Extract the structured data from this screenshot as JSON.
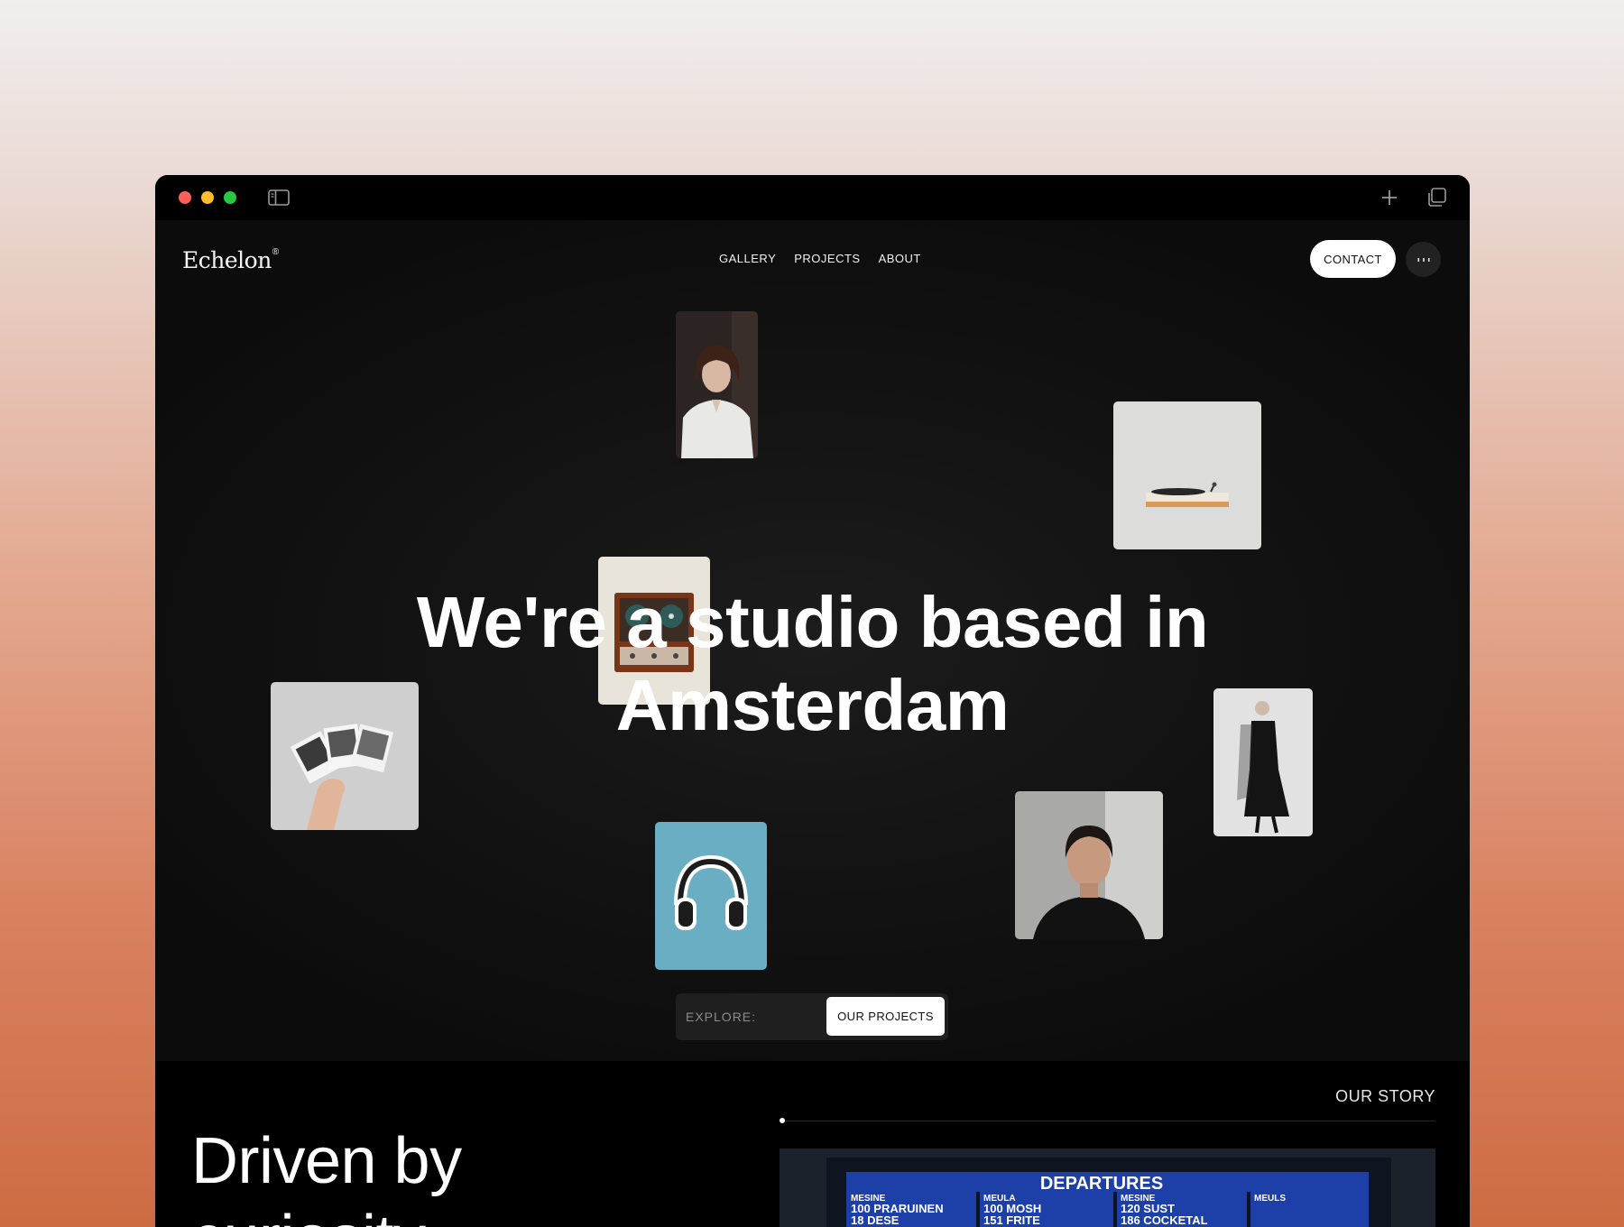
{
  "nav": {
    "logo": "Echelon",
    "logo_mark": "®",
    "links": [
      "GALLERY",
      "PROJECTS",
      "ABOUT"
    ],
    "contact_label": "CONTACT"
  },
  "hero": {
    "title_line1": "We're a studio based in",
    "title_line2": "Amsterdam"
  },
  "explore": {
    "label": "EXPLORE:",
    "button": "OUR PROJECTS"
  },
  "story": {
    "label": "OUR STORY",
    "heading_line1": "Driven by",
    "heading_line2": "curiosity"
  },
  "board": {
    "title": "DEPARTURES",
    "columns": [
      {
        "header": "MESINE",
        "rows": [
          "100 PRARUINEN",
          "18  DESE"
        ]
      },
      {
        "header": "MEULA",
        "rows": [
          "100 MOSH",
          "151 FRITE"
        ]
      },
      {
        "header": "MESINE",
        "rows": [
          "120 SUST",
          "186 COCKETAL"
        ]
      },
      {
        "header": "MEULS",
        "rows": []
      }
    ]
  },
  "colors": {
    "window_bg": "#000000",
    "hero_bg": "#141414",
    "traffic_red": "#fe5f57",
    "traffic_yellow": "#febc2e",
    "traffic_green": "#28c840",
    "board_blue": "#1c3fa8"
  },
  "icons": {
    "sidebar": "sidebar-toggle-icon",
    "new_tab": "plus-icon",
    "tabs": "tab-overview-icon",
    "menu": "more-dots-icon"
  }
}
